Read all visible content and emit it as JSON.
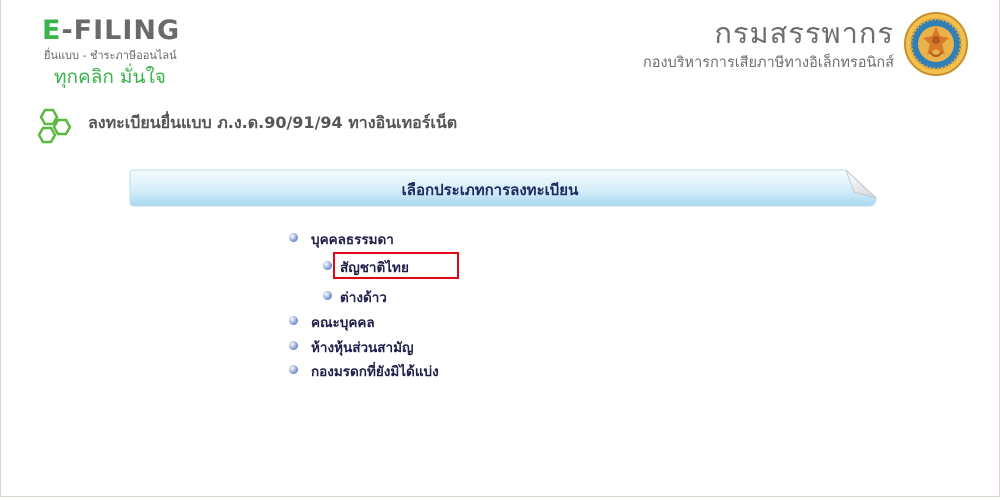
{
  "header": {
    "logo": {
      "prefix": "E",
      "rest": "-FILING",
      "subtitle": "ยื่นแบบ - ชำระภาษีออนไลน์",
      "tagline": "ทุกคลิก มั่นใจ"
    },
    "agency": {
      "title": "กรมสรรพากร",
      "subtitle": "กองบริหารการเสียภาษีทางอิเล็กทรอนิกส์"
    }
  },
  "page": {
    "title": "ลงทะเบียนยื่นแบบ ภ.ง.ด.90/91/94 ทางอินเทอร์เน็ต"
  },
  "section": {
    "title": "เลือกประเภทการลงทะเบียน"
  },
  "menu": {
    "items": [
      {
        "label": "บุคคลธรรมดา"
      },
      {
        "label": "สัญชาติไทย",
        "selected": true
      },
      {
        "label": "ต่างด้าว"
      },
      {
        "label": "คณะบุคคล"
      },
      {
        "label": "ห้างหุ้นส่วนสามัญ"
      },
      {
        "label": "กองมรดกที่ยังมิได้แบ่ง"
      }
    ]
  },
  "colors": {
    "brand_green": "#37b44a",
    "highlight_red": "#e30613",
    "banner_blue": "#bfe3f5",
    "text_navy": "#1f2a60"
  }
}
